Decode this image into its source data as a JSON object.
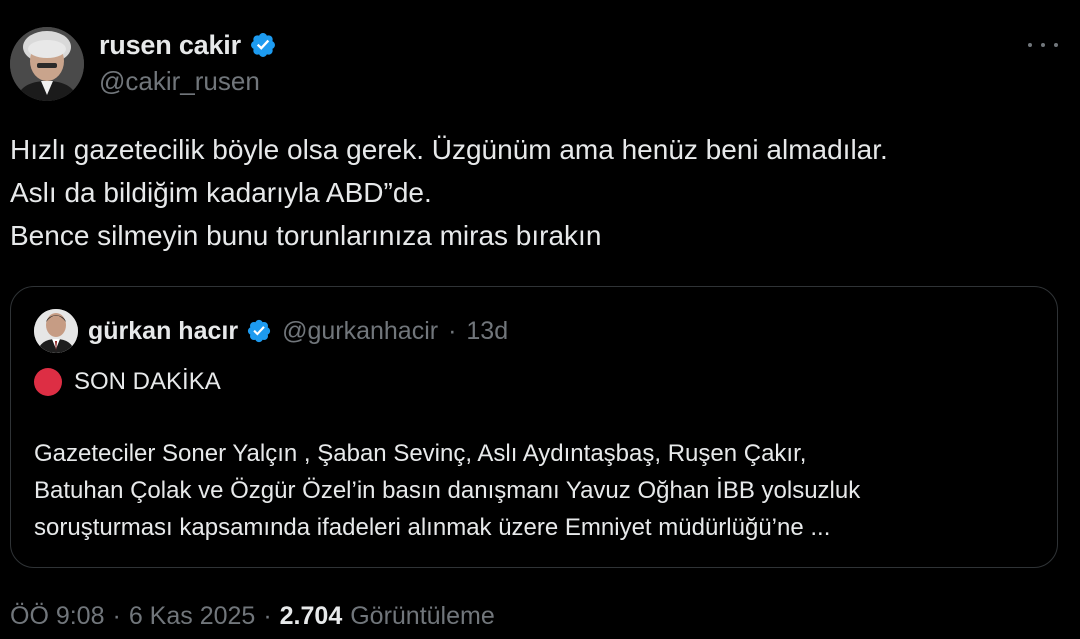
{
  "author": {
    "name": "rusen cakir",
    "handle": "@cakir_rusen",
    "verified_icon": "verified-badge-icon"
  },
  "more_icon": "more-horizontal-icon",
  "tweet_lines": [
    "Hızlı gazetecilik böyle olsa gerek. Üzgünüm ama henüz beni almadılar.",
    "Aslı da bildiğim kadarıyla ABD”de.",
    "Bence silmeyin bunu torunlarınıza miras bırakın"
  ],
  "quote": {
    "name": "gürkan hacır",
    "handle": "@gurkanhacir",
    "separator": "·",
    "time": "13d",
    "breaking_icon": "red-circle-emoji",
    "breaking_label": "SON DAKİKA",
    "body_lines": [
      "Gazeteciler Soner Yalçın , Şaban Sevinç, Aslı Aydıntaşbaş, Ruşen Çakır,",
      "Batuhan Çolak ve Özgür Özel’in basın danışmanı Yavuz Oğhan İBB yolsuzluk",
      "soruşturması kapsamında ifadeleri alınmak üzere Emniyet müdürlüğü’ne ..."
    ]
  },
  "meta": {
    "time": "ÖÖ 9:08",
    "sep1": "·",
    "date": "6 Kas 2025",
    "sep2": "·",
    "views_count": "2.704",
    "views_label": "Görüntüleme"
  },
  "colors": {
    "background": "#000000",
    "text_primary": "#e7e9ea",
    "text_secondary": "#71767b",
    "verified_blue": "#1d9bf0",
    "border": "#2f3336",
    "breaking_red": "#dd2e44"
  }
}
